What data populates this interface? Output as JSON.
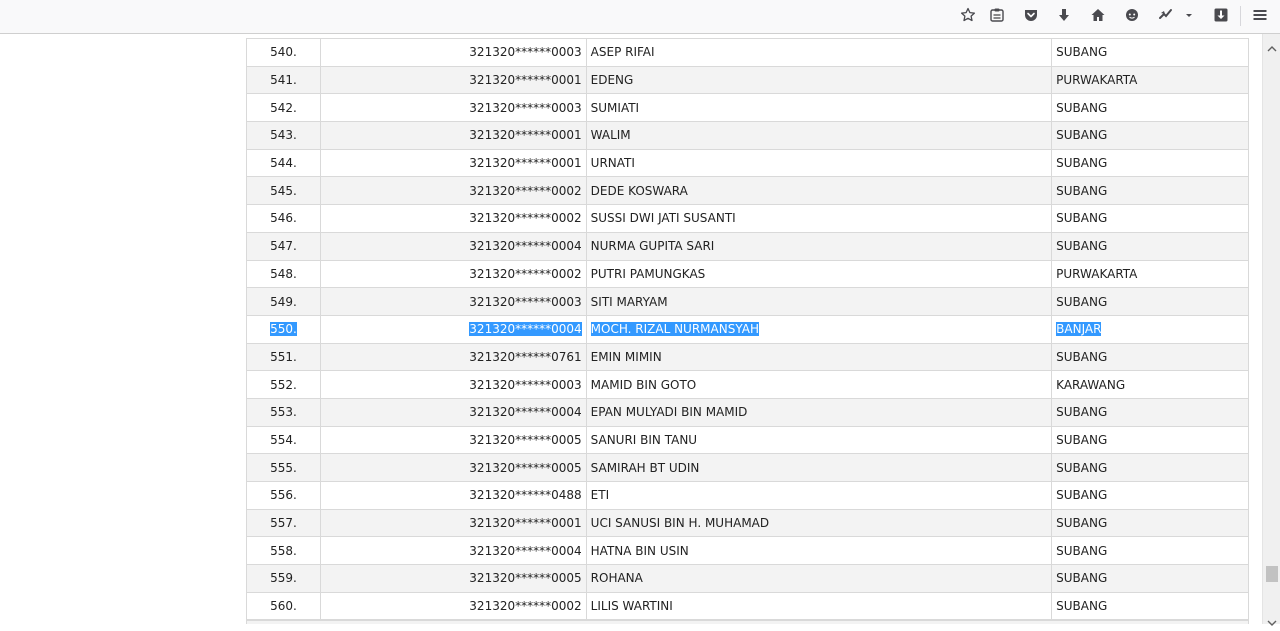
{
  "toolbar": {
    "icons": [
      "star-icon",
      "reading-list-icon",
      "pocket-icon",
      "download-arrow-icon",
      "home-icon",
      "chat-icon",
      "extension-icon",
      "dropdown-arrow-icon",
      "downloads-box-icon",
      "hamburger-menu-icon"
    ]
  },
  "table": {
    "rows": [
      {
        "no": "540.",
        "id": "321320******0003",
        "name": "ASEP RIFAI",
        "city": "SUBANG"
      },
      {
        "no": "541.",
        "id": "321320******0001",
        "name": "EDENG",
        "city": "PURWAKARTA"
      },
      {
        "no": "542.",
        "id": "321320******0003",
        "name": "SUMIATI",
        "city": "SUBANG"
      },
      {
        "no": "543.",
        "id": "321320******0001",
        "name": "WALIM",
        "city": "SUBANG"
      },
      {
        "no": "544.",
        "id": "321320******0001",
        "name": "URNATI",
        "city": "SUBANG"
      },
      {
        "no": "545.",
        "id": "321320******0002",
        "name": "DEDE KOSWARA",
        "city": "SUBANG"
      },
      {
        "no": "546.",
        "id": "321320******0002",
        "name": "SUSSI DWI JATI SUSANTI",
        "city": "SUBANG"
      },
      {
        "no": "547.",
        "id": "321320******0004",
        "name": "NURMA GUPITA SARI",
        "city": "SUBANG"
      },
      {
        "no": "548.",
        "id": "321320******0002",
        "name": "PUTRI PAMUNGKAS",
        "city": "PURWAKARTA"
      },
      {
        "no": "549.",
        "id": "321320******0003",
        "name": "SITI MARYAM",
        "city": "SUBANG"
      },
      {
        "no": "550.",
        "id": "321320******0004",
        "name": "MOCH. RIZAL NURMANSYAH",
        "city": "BANJAR",
        "selected": true
      },
      {
        "no": "551.",
        "id": "321320******0761",
        "name": "EMIN MIMIN",
        "city": "SUBANG"
      },
      {
        "no": "552.",
        "id": "321320******0003",
        "name": "MAMID BIN GOTO",
        "city": "KARAWANG"
      },
      {
        "no": "553.",
        "id": "321320******0004",
        "name": "EPAN MULYADI BIN MAMID",
        "city": "SUBANG"
      },
      {
        "no": "554.",
        "id": "321320******0005",
        "name": "SANURI BIN TANU",
        "city": "SUBANG"
      },
      {
        "no": "555.",
        "id": "321320******0005",
        "name": "SAMIRAH BT UDIN",
        "city": "SUBANG"
      },
      {
        "no": "556.",
        "id": "321320******0488",
        "name": "ETI",
        "city": "SUBANG"
      },
      {
        "no": "557.",
        "id": "321320******0001",
        "name": "UCI SANUSI BIN H. MUHAMAD",
        "city": "SUBANG"
      },
      {
        "no": "558.",
        "id": "321320******0004",
        "name": "HATNA BIN USIN",
        "city": "SUBANG"
      },
      {
        "no": "559.",
        "id": "321320******0005",
        "name": "ROHANA",
        "city": "SUBANG"
      },
      {
        "no": "560.",
        "id": "321320******0002",
        "name": "LILIS WARTINI",
        "city": "SUBANG"
      }
    ]
  },
  "colors": {
    "selection": "#3399ff",
    "row_alt": "#f3f3f3",
    "border": "#d9d9d9"
  }
}
